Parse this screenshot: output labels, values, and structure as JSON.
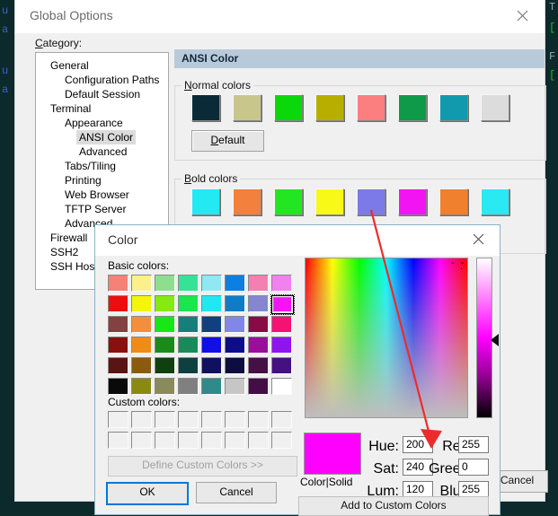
{
  "terminal": {
    "left_fragments": [
      "u",
      "a",
      "u",
      "a"
    ],
    "right_fragments": [
      "T",
      "[",
      "F",
      "["
    ]
  },
  "global_options": {
    "title": "Global Options",
    "close_icon": "close-icon",
    "category_label": "Category:",
    "cancel_label": "Cancel",
    "tree": [
      {
        "label": "General",
        "indent": 0,
        "chevron": "chevron-down-icon",
        "selected": false
      },
      {
        "label": "Configuration Paths",
        "indent": 1,
        "chevron": "",
        "selected": false
      },
      {
        "label": "Default Session",
        "indent": 1,
        "chevron": "",
        "selected": false
      },
      {
        "label": "Terminal",
        "indent": 0,
        "chevron": "chevron-down-icon",
        "selected": false
      },
      {
        "label": "Appearance",
        "indent": 1,
        "chevron": "chevron-down-icon",
        "selected": false
      },
      {
        "label": "ANSI Color",
        "indent": 2,
        "chevron": "",
        "selected": true
      },
      {
        "label": "Advanced",
        "indent": 2,
        "chevron": "",
        "selected": false
      },
      {
        "label": "Tabs/Tiling",
        "indent": 1,
        "chevron": "",
        "selected": false
      },
      {
        "label": "Printing",
        "indent": 1,
        "chevron": "",
        "selected": false
      },
      {
        "label": "Web Browser",
        "indent": 1,
        "chevron": "",
        "selected": false
      },
      {
        "label": "TFTP Server",
        "indent": 1,
        "chevron": "",
        "selected": false
      },
      {
        "label": "Advanced",
        "indent": 1,
        "chevron": "",
        "selected": false
      },
      {
        "label": "Firewall",
        "indent": 0,
        "chevron": "",
        "selected": false
      },
      {
        "label": "SSH2",
        "indent": 0,
        "chevron": "",
        "selected": false
      },
      {
        "label": "SSH Host Keys",
        "indent": 0,
        "chevron": "",
        "selected": false
      }
    ],
    "pane": {
      "header": "ANSI Color",
      "normal_group_title": "Normal colors",
      "bold_group_title": "Bold colors",
      "default_button": "Default",
      "normal_colors": [
        "#0a2a38",
        "#c9c68c",
        "#0ad80a",
        "#b8ae00",
        "#fb7f7f",
        "#0f9a4a",
        "#119aae",
        "#dcdcdc"
      ],
      "bold_colors": [
        "#22e9f2",
        "#f3803c",
        "#22e622",
        "#f9f918",
        "#7b7ae8",
        "#f314f3",
        "#f0802e",
        "#2ae9f2"
      ]
    }
  },
  "color_dialog": {
    "title": "Color",
    "close_icon": "close-icon",
    "basic_label": "Basic colors:",
    "custom_label": "Custom colors:",
    "define_button": "Define Custom Colors >>",
    "ok_button": "OK",
    "cancel_button": "Cancel",
    "add_custom_button": "Add to Custom Colors",
    "color_solid_label": "Color|Solid",
    "selected_index": 15,
    "basic_colors": [
      "#f58177",
      "#fbf08a",
      "#8fde8f",
      "#36e396",
      "#8fe8f2",
      "#0d7fe0",
      "#f280b0",
      "#ef82ef",
      "#ec0d0d",
      "#f5f50a",
      "#84ea12",
      "#1ae64e",
      "#20e8f2",
      "#0f7cc8",
      "#8486d0",
      "#f712f7",
      "#84413f",
      "#f58e3c",
      "#17e617",
      "#167f7a",
      "#113f7f",
      "#8187e8",
      "#8a0a46",
      "#f41272",
      "#8a0f0f",
      "#f08b17",
      "#1a8a1a",
      "#1a8a5a",
      "#100fe8",
      "#0d0d8a",
      "#9a0f9a",
      "#8e14f0",
      "#5a1414",
      "#8a5a0f",
      "#103f10",
      "#0f4040",
      "#101060",
      "#0d0d40",
      "#451045",
      "#451080",
      "#0a0a0a",
      "#8a8a0f",
      "#8a8a5a",
      "#808080",
      "#2f8a8a",
      "#c6c6c6",
      "#450d45",
      "#ffffff"
    ],
    "custom_colors_count": 16,
    "hsl": {
      "hue_label": "Hue:",
      "hue_value": "200",
      "sat_label": "Sat:",
      "sat_value": "240",
      "lum_label": "Lum:",
      "lum_value": "120"
    },
    "rgb": {
      "red_label": "Red:",
      "red_value": "255",
      "green_label": "Green:",
      "green_value": "0",
      "blue_label": "Blue:",
      "blue_value": "255"
    },
    "current_color": "#ff00ff"
  },
  "annotation": {
    "arrow_color": "#ee2b2b"
  }
}
